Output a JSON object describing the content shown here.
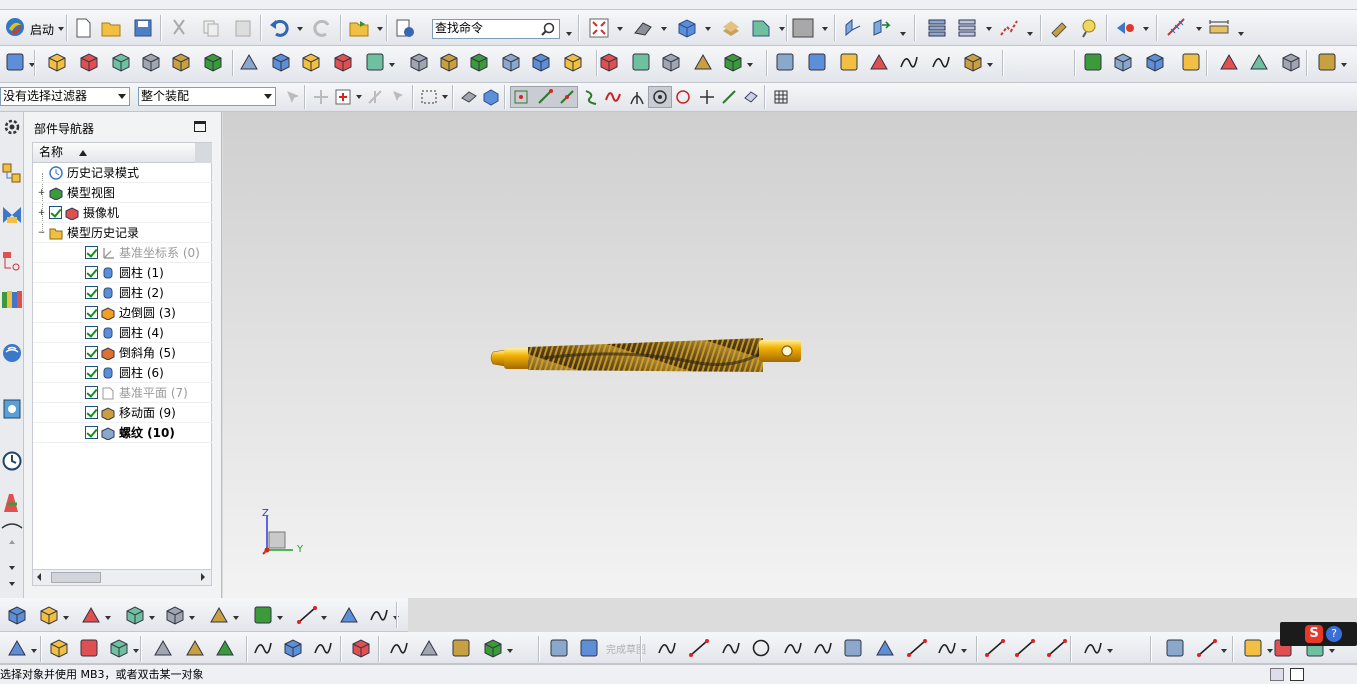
{
  "toolbar1": {
    "start_label": "启动",
    "search_placeholder": "查找命令"
  },
  "toolbar3": {
    "selection_filter": "没有选择过滤器",
    "scope": "整个装配"
  },
  "navigator": {
    "title": "部件导航器",
    "column_name": "名称",
    "items": [
      {
        "label": "历史记录模式",
        "icon": "clock-icon",
        "level": 0,
        "expander": "",
        "checked": false,
        "dim": false,
        "bold": false
      },
      {
        "label": "模型视图",
        "icon": "model-view-icon",
        "level": 0,
        "expander": "+",
        "checked": false,
        "dim": false,
        "bold": false
      },
      {
        "label": "摄像机",
        "icon": "camera-icon",
        "level": 0,
        "expander": "+",
        "checked": true,
        "dim": false,
        "bold": false
      },
      {
        "label": "模型历史记录",
        "icon": "folder-icon",
        "level": 0,
        "expander": "−",
        "checked": false,
        "dim": false,
        "bold": false
      },
      {
        "label": "基准坐标系 (0)",
        "icon": "datum-csys-icon",
        "level": 1,
        "checked": true,
        "dim": true,
        "bold": false
      },
      {
        "label": "圆柱 (1)",
        "icon": "cylinder-icon",
        "level": 1,
        "checked": true,
        "dim": false,
        "bold": false
      },
      {
        "label": "圆柱 (2)",
        "icon": "cylinder-icon",
        "level": 1,
        "checked": true,
        "dim": false,
        "bold": false
      },
      {
        "label": "边倒圆 (3)",
        "icon": "edge-blend-icon",
        "level": 1,
        "checked": true,
        "dim": false,
        "bold": false
      },
      {
        "label": "圆柱 (4)",
        "icon": "cylinder-icon",
        "level": 1,
        "checked": true,
        "dim": false,
        "bold": false
      },
      {
        "label": "倒斜角 (5)",
        "icon": "chamfer-icon",
        "level": 1,
        "checked": true,
        "dim": false,
        "bold": false
      },
      {
        "label": "圆柱 (6)",
        "icon": "cylinder-icon",
        "level": 1,
        "checked": true,
        "dim": false,
        "bold": false
      },
      {
        "label": "基准平面 (7)",
        "icon": "datum-plane-icon",
        "level": 1,
        "checked": true,
        "dim": true,
        "bold": false
      },
      {
        "label": "移动面 (9)",
        "icon": "move-face-icon",
        "level": 1,
        "checked": true,
        "dim": false,
        "bold": false
      },
      {
        "label": "螺纹 (10)",
        "icon": "thread-icon",
        "level": 1,
        "checked": true,
        "dim": false,
        "bold": true
      }
    ]
  },
  "viewport": {
    "triad": {
      "z": "Z",
      "y": "Y"
    }
  },
  "sketch_toolbar": {
    "finish_sketch": "完成草图"
  },
  "status": {
    "message": "选择对象并使用 MB3，或者双击某一对象"
  },
  "colors": {
    "part_gold": "#e8a200",
    "thread_dark": "#6b5320",
    "accent_blue": "#3b78c8",
    "toolbar_bg": "#e8ebef"
  }
}
